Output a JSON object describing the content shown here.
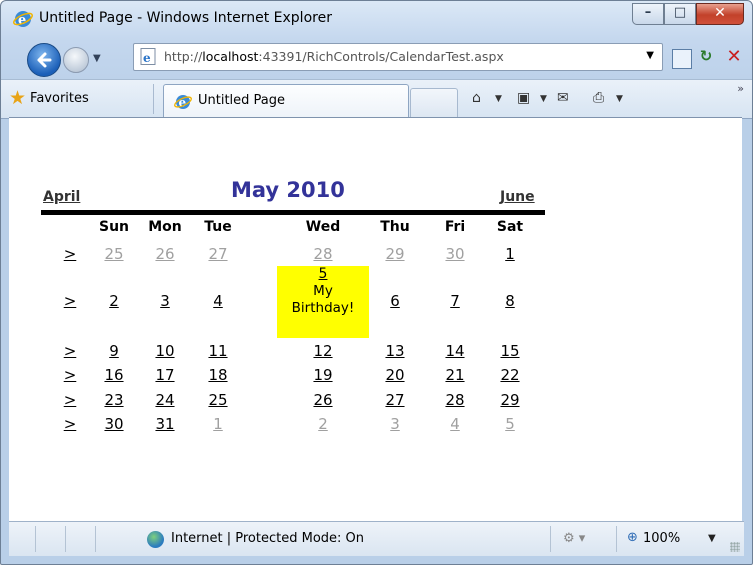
{
  "window": {
    "title": "Untitled Page - Windows Internet Explorer",
    "buttons": {
      "minimize": "–",
      "maximize": "□",
      "close": "✕"
    }
  },
  "navigation": {
    "address": "http://localhost:43391/RichControls/CalendarTest.aspx",
    "address_host": "localhost",
    "address_prefix": "http://",
    "address_suffix": ":43391/RichControls/CalendarTest.aspx"
  },
  "favorites_bar": {
    "favorites_label": "Favorites",
    "tab_label": "Untitled Page"
  },
  "calendar": {
    "prev_month": "April",
    "next_month": "June",
    "title": "May 2010",
    "day_names": [
      "Sun",
      "Mon",
      "Tue",
      "Wed",
      "Thu",
      "Fri",
      "Sat"
    ],
    "week_selector": ">",
    "weeks": [
      [
        "25",
        "26",
        "27",
        "28",
        "29",
        "30",
        "1"
      ],
      [
        "2",
        "3",
        "4",
        "5",
        "6",
        "7",
        "8"
      ],
      [
        "9",
        "10",
        "11",
        "12",
        "13",
        "14",
        "15"
      ],
      [
        "16",
        "17",
        "18",
        "19",
        "20",
        "21",
        "22"
      ],
      [
        "23",
        "24",
        "25",
        "26",
        "27",
        "28",
        "29"
      ],
      [
        "30",
        "31",
        "1",
        "2",
        "3",
        "4",
        "5"
      ]
    ],
    "special_day": {
      "day": "5",
      "text_line1": "My",
      "text_line2": "Birthday!"
    }
  },
  "status_bar": {
    "zone_text": "Internet | Protected Mode: On",
    "zoom": "100%"
  },
  "colors": {
    "calendar_title": "#333399",
    "highlight": "#ffff00",
    "other_month": "#a0a0a0"
  }
}
